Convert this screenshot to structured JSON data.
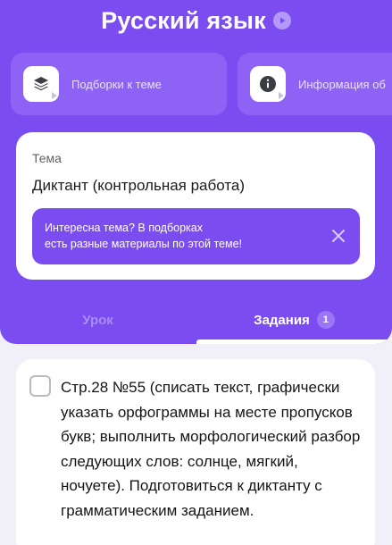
{
  "header": {
    "title": "Русский язык",
    "accent_color": "#7b4cf0",
    "shortcuts": [
      {
        "icon": "layers-icon",
        "label": "Подборки к теме"
      },
      {
        "icon": "info-icon",
        "label": "Информация об"
      }
    ]
  },
  "topic": {
    "label": "Тема",
    "value": "Диктант (контрольная работа)",
    "hint": {
      "line1": "Интересна тема? В подборках",
      "line2": "есть разные материалы по этой теме!"
    }
  },
  "tabs": {
    "lesson": "Урок",
    "tasks": "Задания",
    "tasks_count": "1",
    "active": "tasks"
  },
  "task": {
    "text": "Стр.28 №55 (списать текст, графически указать орфограммы на месте пропусков букв; выполнить морфологический разбор следующих слов: солнце, мягкий, ночуете). Подготовиться к диктанту с грамматическим заданием.",
    "checked": false
  }
}
